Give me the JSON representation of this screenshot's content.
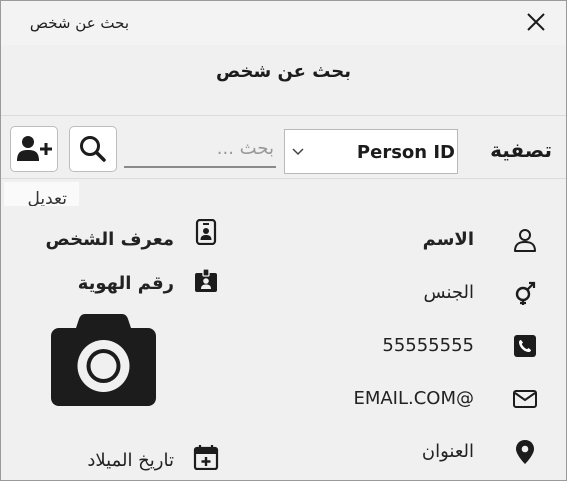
{
  "window": {
    "title": "بحث عن شخص"
  },
  "header": {
    "title": "بحث عن شخص"
  },
  "filter": {
    "label": "تصفية",
    "selected_option": "Person ID",
    "search_placeholder": "بحث ..."
  },
  "tabs": {
    "edit_label": "تعديل"
  },
  "details": {
    "name_label": "الاسم",
    "gender_label": "الجنس",
    "phone_value": "55555555",
    "email_value": "EMAIL.COM@",
    "address_label": "العنوان",
    "person_id_label": "معرف الشخص",
    "national_id_label": "رقم الهوية",
    "birthdate_label": "تاريخ الميلاد"
  },
  "icons": {
    "close": "close-icon",
    "chevron": "chevron-down-icon",
    "search": "search-icon",
    "add_person": "add-person-icon",
    "user": "user-icon",
    "gender": "gender-icon",
    "phone": "phone-icon",
    "email": "envelope-icon",
    "address": "location-pin-icon",
    "badge": "badge-icon",
    "id_card": "id-card-icon",
    "calendar": "calendar-plus-icon",
    "camera": "camera-icon"
  },
  "colors": {
    "icon": "#1c1c1c",
    "background": "#f0f0f0"
  }
}
